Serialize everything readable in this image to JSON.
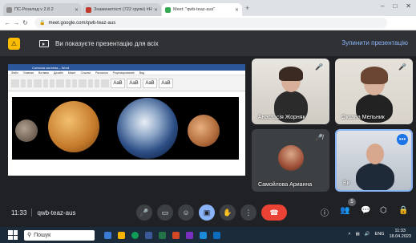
{
  "browser": {
    "tabs": [
      {
        "title": "ПС-Розклад v 2.8.2",
        "active": false,
        "color": "#8a8a8a"
      },
      {
        "title": "Знаменитості (722 групи) #НЦ",
        "active": false,
        "color": "#c0392b"
      },
      {
        "title": "Meet: \"qwb-teaz-aus\"",
        "active": true,
        "color": "#34a853"
      }
    ],
    "url": "meet.google.com/qwb-teaz-aus"
  },
  "banner": {
    "text": "Ви показуєте презентацію для всіх",
    "stop_label": "Зупинити презентацію"
  },
  "document": {
    "app_title": "Сонячна система – Word",
    "menu": [
      "Файл",
      "Главная",
      "Вставка",
      "Дизайн",
      "Макет",
      "Ссылки",
      "Рассылки",
      "Рецензирование",
      "Вид"
    ],
    "style_label": "AaB"
  },
  "participants": [
    {
      "name": "Анастасія Жорняк",
      "muted": true
    },
    {
      "name": "Оксана Мельник",
      "muted": true
    },
    {
      "name": "Самойлова Арианна",
      "muted": true
    },
    {
      "name": "Ви",
      "muted": true
    }
  ],
  "meeting": {
    "time": "11:33",
    "code": "qwb-teaz-aus",
    "participant_count": "5"
  },
  "taskbar": {
    "search_label": "Пошук",
    "lang": "ENG",
    "time": "11:33",
    "date": "18.04.2023"
  }
}
